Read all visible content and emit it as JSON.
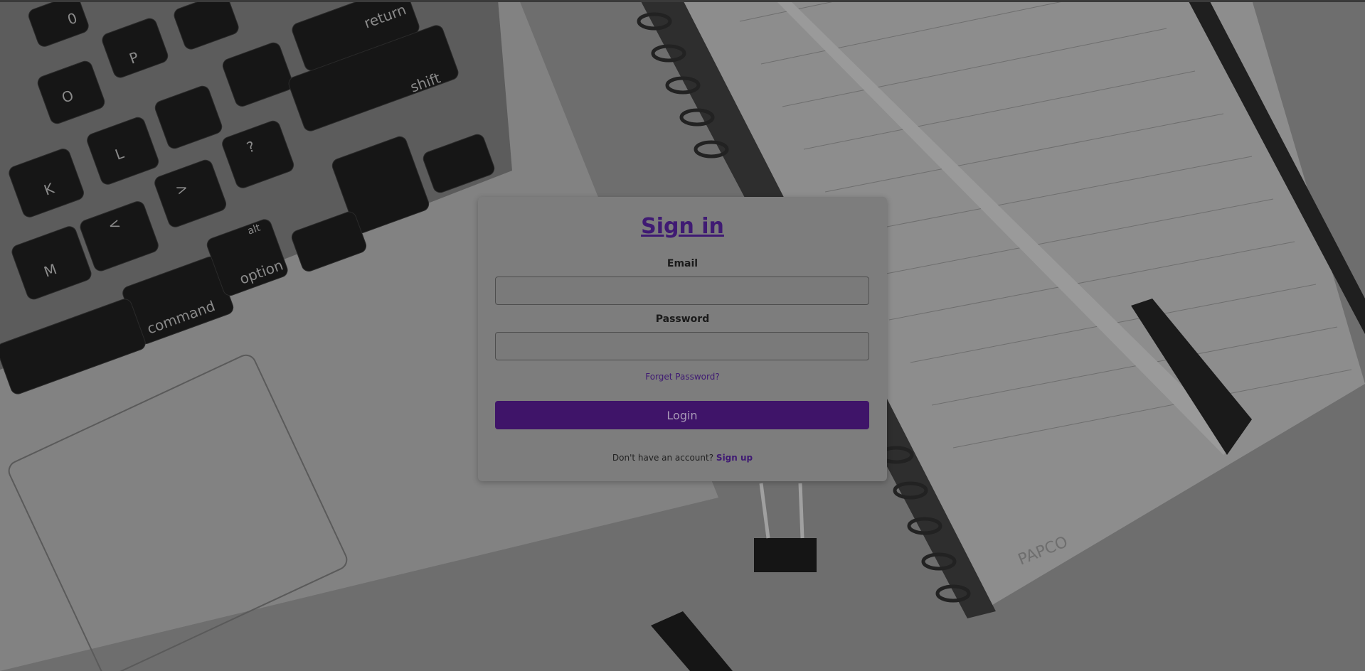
{
  "login_card": {
    "title": "Sign in",
    "email_label": "Email",
    "email_value": "",
    "password_label": "Password",
    "password_value": "",
    "forgot_password": "Forget Password?",
    "login_button": "Login",
    "no_account_text": "Don't have an account?",
    "signup_link": "Sign up"
  },
  "background_photo": {
    "brand_mark": "PAPCO",
    "keyboard_keys": [
      "0",
      "P",
      "return",
      "O",
      "shift",
      "L",
      "K",
      ">",
      "<",
      "M",
      "command",
      "alt",
      "option",
      "?",
      "\""
    ]
  },
  "colors": {
    "accent": "#3f1a73",
    "button": "#3f1469",
    "card": "#7d7d7d"
  }
}
